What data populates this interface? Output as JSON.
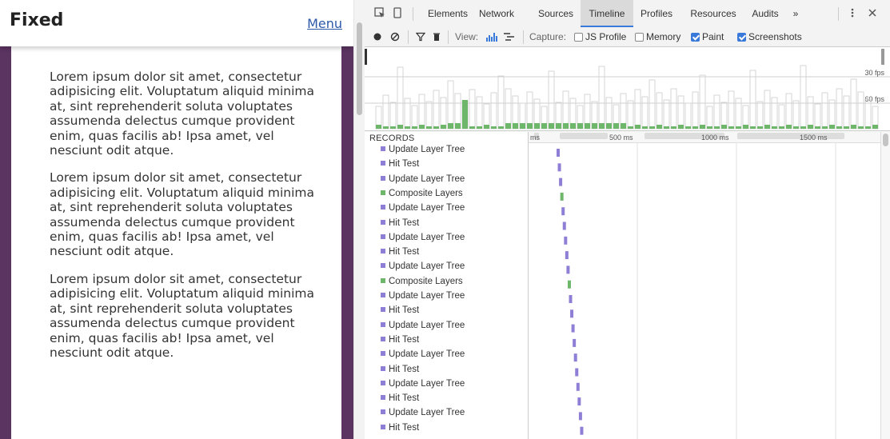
{
  "page": {
    "header_title": "Fixed",
    "menu_label": "Menu",
    "paragraphs": [
      "Lorem ipsum dolor sit amet, consectetur adipisicing elit. Voluptatum aliquid minima at, sint reprehenderit soluta voluptates assumenda delectus cumque provident enim, quas facilis ab! Ipsa amet, vel nesciunt odit atque.",
      "Lorem ipsum dolor sit amet, consectetur adipisicing elit. Voluptatum aliquid minima at, sint reprehenderit soluta voluptates assumenda delectus cumque provident enim, quas facilis ab! Ipsa amet, vel nesciunt odit atque.",
      "Lorem ipsum dolor sit amet, consectetur adipisicing elit. Voluptatum aliquid minima at, sint reprehenderit soluta voluptates assumenda delectus cumque provident enim, quas facilis ab! Ipsa amet, vel nesciunt odit atque."
    ]
  },
  "devtools": {
    "tabs": [
      "Elements",
      "Network",
      "Sources",
      "Timeline",
      "Profiles",
      "Resources",
      "Audits",
      "»"
    ],
    "active_tab": "Timeline",
    "toolbar": {
      "view_label": "View:",
      "capture_label": "Capture:",
      "capture_options": [
        {
          "label": "JS Profile",
          "checked": false
        },
        {
          "label": "Memory",
          "checked": false
        },
        {
          "label": "Paint",
          "checked": true
        },
        {
          "label": "Screenshots",
          "checked": true
        }
      ]
    },
    "overview": {
      "fps_labels": [
        "30 fps",
        "60 fps"
      ]
    },
    "ruler_labels": [
      "ms",
      "500 ms",
      "1000 ms",
      "1500 ms"
    ],
    "records_header": "RECORDS",
    "records": [
      {
        "label": "Update Layer Tree",
        "type": "layout"
      },
      {
        "label": "Hit Test",
        "type": "layout"
      },
      {
        "label": "Update Layer Tree",
        "type": "layout"
      },
      {
        "label": "Composite Layers",
        "type": "paint"
      },
      {
        "label": "Update Layer Tree",
        "type": "layout"
      },
      {
        "label": "Hit Test",
        "type": "layout"
      },
      {
        "label": "Update Layer Tree",
        "type": "layout"
      },
      {
        "label": "Hit Test",
        "type": "layout"
      },
      {
        "label": "Update Layer Tree",
        "type": "layout"
      },
      {
        "label": "Composite Layers",
        "type": "paint"
      },
      {
        "label": "Update Layer Tree",
        "type": "layout"
      },
      {
        "label": "Hit Test",
        "type": "layout"
      },
      {
        "label": "Update Layer Tree",
        "type": "layout"
      },
      {
        "label": "Hit Test",
        "type": "layout"
      },
      {
        "label": "Update Layer Tree",
        "type": "layout"
      },
      {
        "label": "Hit Test",
        "type": "layout"
      },
      {
        "label": "Update Layer Tree",
        "type": "layout"
      },
      {
        "label": "Hit Test",
        "type": "layout"
      },
      {
        "label": "Update Layer Tree",
        "type": "layout"
      },
      {
        "label": "Hit Test",
        "type": "layout"
      }
    ],
    "colors": {
      "layout": "#8f7ed6",
      "paint": "#6db66a",
      "active_tab_underline": "#3879d9",
      "page_background": "#5b3461",
      "menu_link": "#2b59a8"
    }
  }
}
